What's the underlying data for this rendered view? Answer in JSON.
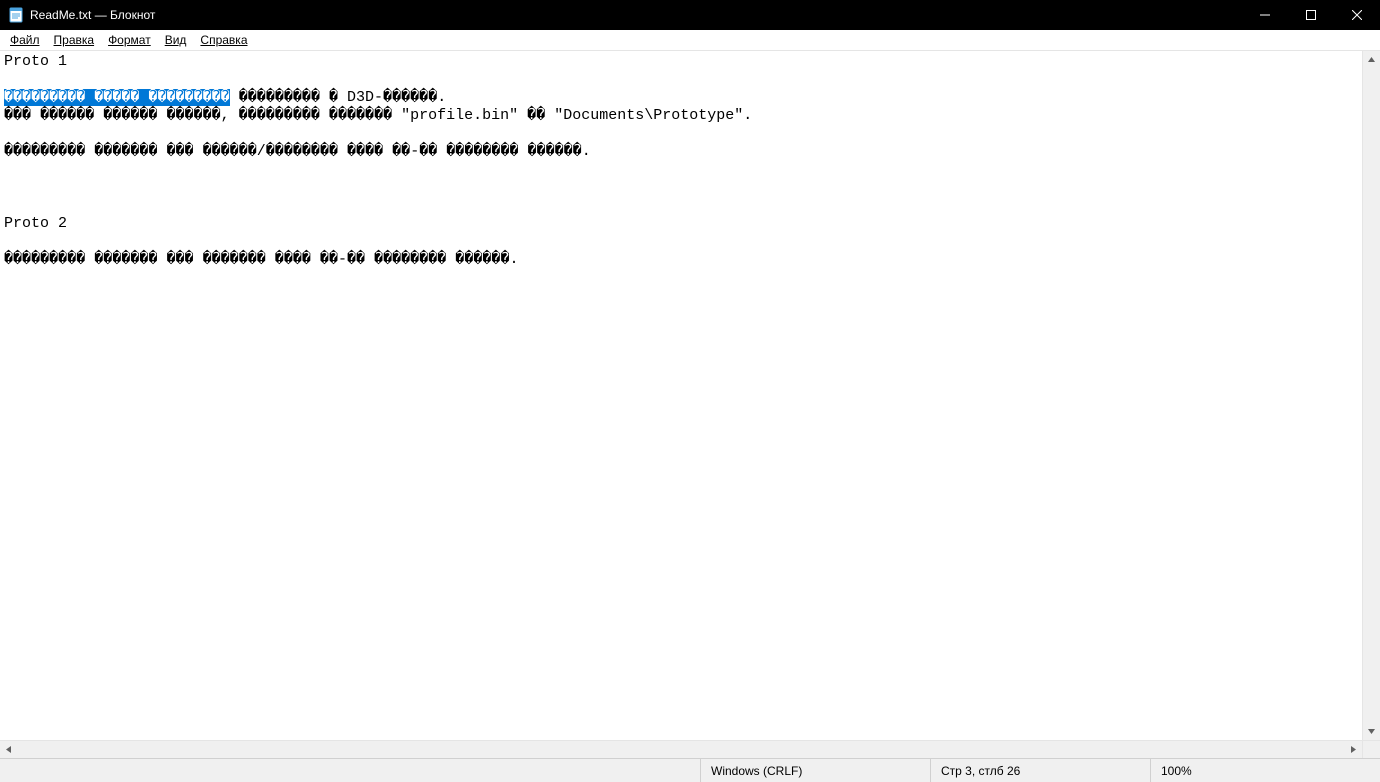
{
  "titlebar": {
    "title": "ReadMe.txt — Блокнот"
  },
  "menu": {
    "file": "Файл",
    "edit": "Правка",
    "format": "Формат",
    "view": "Вид",
    "help": "Справка"
  },
  "editor": {
    "line1": "Proto 1",
    "line2": "",
    "line3_sel": "��������� ����� ���������",
    "line3_rest": " ��������� � D3D-������.",
    "line4": "��� ������ ������ ������, ��������� ������� \"profile.bin\" �� \"Documents\\Prototype\".",
    "line5": "",
    "line6": "��������� ������� ��� ������/�������� ���� ��-�� �������� ������.",
    "line7": "",
    "line8": "",
    "line9": "",
    "line10": "Proto 2",
    "line11": "",
    "line12": "��������� ������� ��� ������� ���� ��-�� �������� ������."
  },
  "statusbar": {
    "encoding": "Windows (CRLF)",
    "position": "Стр 3, стлб 26",
    "zoom": "100%"
  }
}
